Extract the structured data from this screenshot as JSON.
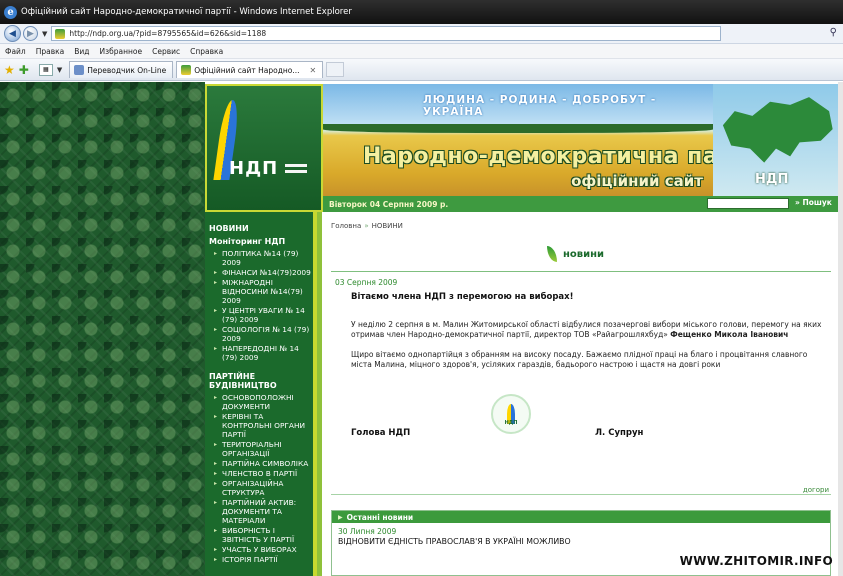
{
  "window": {
    "title": "Офіційний сайт Народно-демократичної партії - Windows Internet Explorer"
  },
  "address": {
    "url": "http://ndp.org.ua/?pid=8795565&id=626&sid=1188"
  },
  "menu": [
    "Файл",
    "Правка",
    "Вид",
    "Избранное",
    "Сервис",
    "Справка"
  ],
  "tabs": [
    {
      "label": "Переводчик On-Line"
    },
    {
      "label": "Офіційний сайт Народно..."
    }
  ],
  "site": {
    "logo_text": "НДП",
    "slogan": "ЛЮДИНА - РОДИНА - ДОБРОБУТ - УКРАЇНА",
    "party_name": "Народно-демократична партія",
    "official": "офіційний сайт",
    "map_label": "НДП",
    "date": "Вівторок 04 Серпня 2009 р.",
    "search_button": "Пошук"
  },
  "sidebar": {
    "news": "НОВИНИ",
    "monitoring": "Моніторинг НДП",
    "monitoring_items": [
      "ПОЛІТИКА №14 (79) 2009",
      "ФІНАНСИ №14(79)2009",
      "МІЖНАРОДНІ ВІДНОСИНИ №14(79) 2009",
      "У ЦЕНТРІ УВАГИ № 14 (79) 2009",
      "СОЦІОЛОГІЯ № 14 (79) 2009",
      "НАПЕРЕДОДНІ № 14 (79) 2009"
    ],
    "party_building": "ПАРТІЙНЕ БУДІВНИЦТВО",
    "party_items": [
      "ОСНОВОПОЛОЖНІ ДОКУМЕНТИ",
      "КЕРІВНІ ТА КОНТРОЛЬНІ ОРГАНИ ПАРТІЇ",
      "ТЕРИТОРІАЛЬНІ ОРГАНІЗАЦІЇ",
      "ПАРТІЙНА СИМВОЛІКА",
      "ЧЛЕНСТВО В ПАРТІЇ",
      "ОРГАНІЗАЦІЙНА СТРУКТУРА",
      "ПАРТІЙНИЙ АКТИВ: ДОКУМЕНТИ ТА МАТЕРІАЛИ",
      "ВИБОРНІСТЬ І ЗВІТНІСТЬ У ПАРТІЇ",
      "УЧАСТЬ У ВИБОРАХ",
      "ІСТОРІЯ ПАРТІЇ"
    ]
  },
  "content": {
    "breadcrumb_home": "Головна",
    "breadcrumb_current": "НОВИНИ",
    "section_title": "новини",
    "news_date": "03 Серпня 2009",
    "news_title": "Вітаємо члена НДП з перемогою на виборах!",
    "paragraph1_a": "У неділю 2 серпня в м. Малин Житомирської області відбулися позачергові вибори міського голови, перемогу на яких отримав член Народно-демократичної партії, директор ТОВ «Райагрошляхбуд» ",
    "paragraph1_b": "Фещенко Микола Іванович",
    "paragraph2": "Щиро вітаємо однопартійця з обранням на високу посаду. Бажаємо плідної праці на благо і процвітання славного міста Малина, міцного здоров'я, усіляких гараздів, бадьорого настрою і щастя на довгі роки",
    "sig_left": "Голова НДП",
    "sig_right": "Л. Супрун",
    "emblem_label": "НДП",
    "more": "догори",
    "latest_title": "Останні новини",
    "latest_date": "30 Липня 2009",
    "latest_text": "ВІДНОВИТИ ЄДНІСТЬ ПРАВОСЛАВ'Я В УКРАЇНІ МОЖЛИВО"
  },
  "watermark": "WWW.ZHITOMIR.INFO",
  "colors": {
    "green_dark": "#1b6a2c",
    "green_bar": "#3e9a40",
    "accent_lime": "#c7d92f"
  }
}
